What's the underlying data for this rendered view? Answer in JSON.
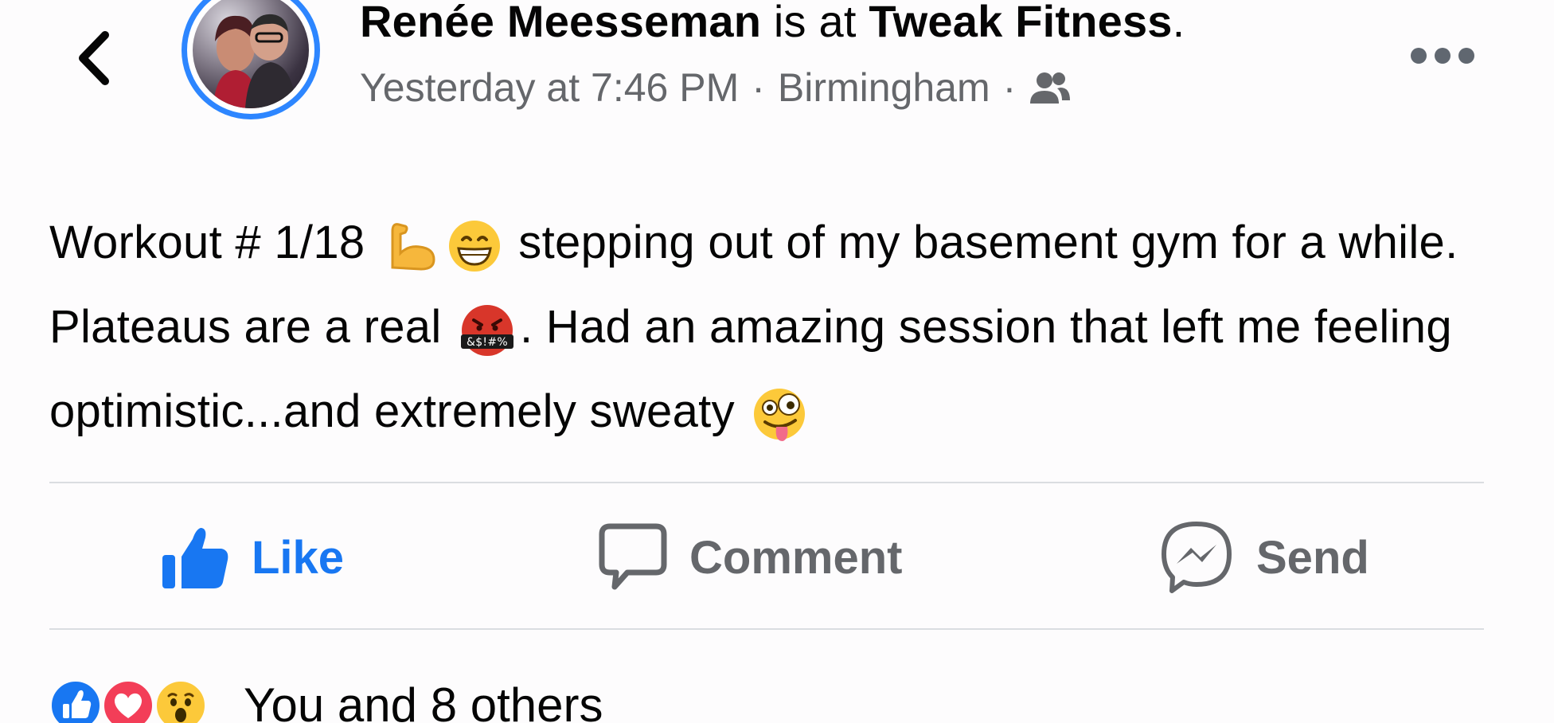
{
  "header": {
    "author_name": "Renée Meesseman",
    "is_at": " is at ",
    "place": "Tweak Fitness",
    "period": ".",
    "timestamp": "Yesterday at 7:46 PM",
    "separator": "·",
    "location": "Birmingham",
    "audience_icon": "friends-icon",
    "more_icon": "more-options-icon",
    "back_icon": "back-chevron-icon"
  },
  "post": {
    "segments": [
      "Workout # 1/18 ",
      " stepping out of my basement gym for a while. Plateaus are a real ",
      ". Had an amazing session that left me feeling optimistic...and extremely sweaty "
    ],
    "emojis": [
      "flexed-biceps",
      "grinning-face",
      "cursing-face",
      "zany-face"
    ]
  },
  "actions": {
    "like_label": "Like",
    "comment_label": "Comment",
    "send_label": "Send"
  },
  "reactions": {
    "types": [
      "like",
      "love",
      "wow"
    ],
    "summary": "You and 8 others"
  },
  "colors": {
    "accent": "#1877f2",
    "avatar_ring": "#2d86ff",
    "secondary_text": "#65676b",
    "primary_text": "#050505",
    "divider": "#dadde1",
    "love": "#f33e58"
  }
}
